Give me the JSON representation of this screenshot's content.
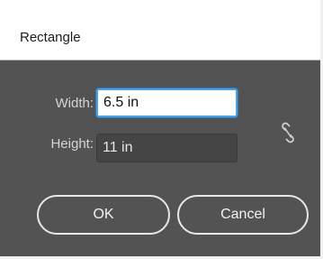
{
  "dialog": {
    "title": "Rectangle",
    "width_label": "Width:",
    "width_value": "6.5 in",
    "height_label": "Height:",
    "height_value": "11 in",
    "link_icon": "broken-chain-link-icon",
    "ok_label": "OK",
    "cancel_label": "Cancel"
  }
}
